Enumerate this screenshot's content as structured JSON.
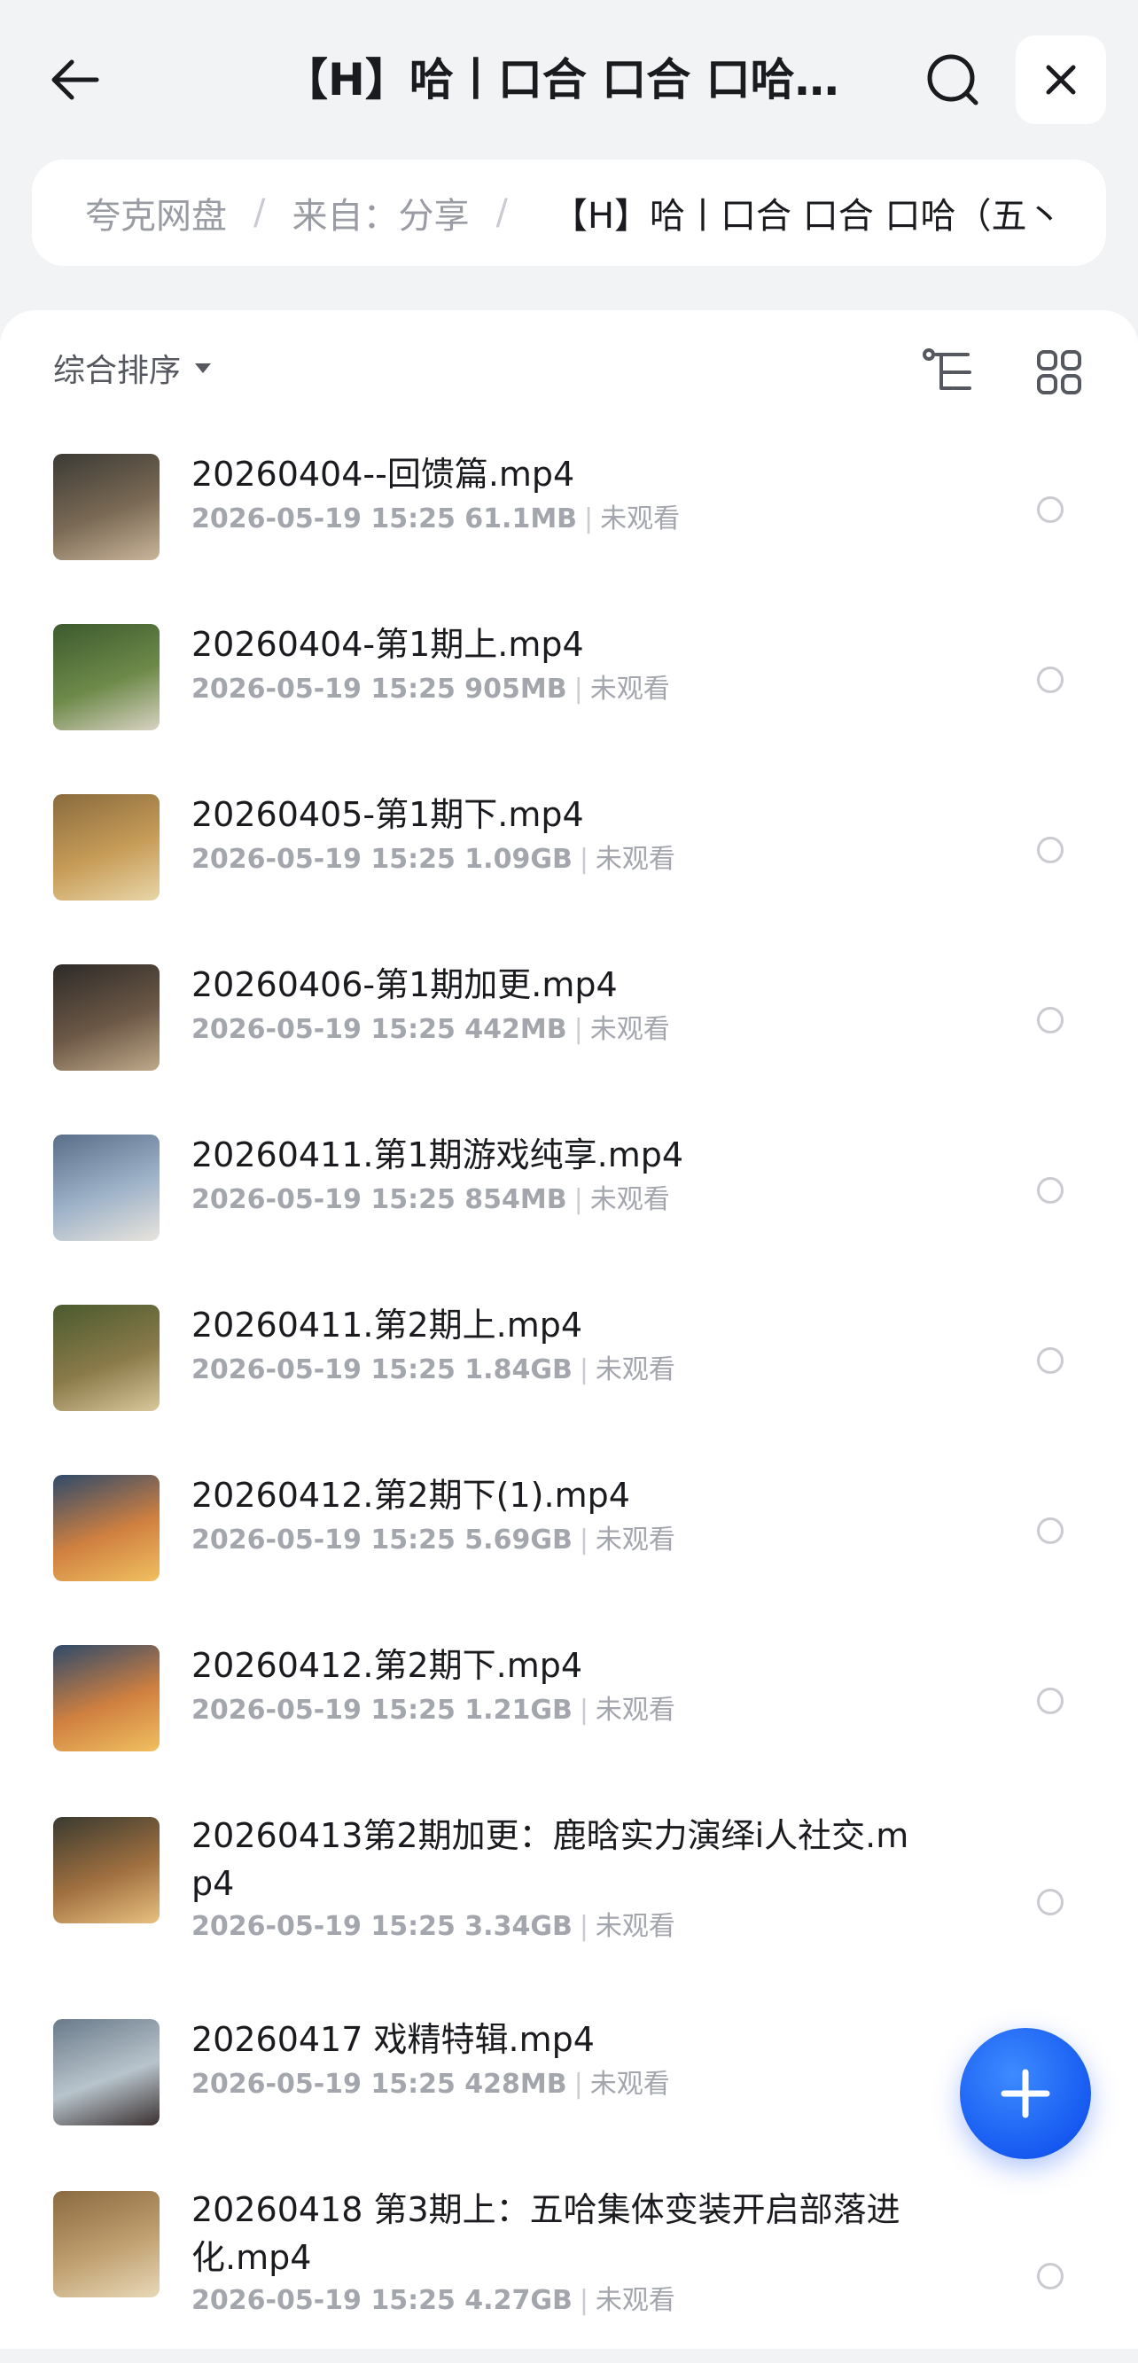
{
  "header": {
    "title": "【H】哈丨口合 口合 口哈（...",
    "back_icon": "arrow-left-icon",
    "search_icon": "search-icon",
    "close_icon": "close-icon"
  },
  "breadcrumb": {
    "items": [
      "夸克网盘",
      "来自：分享"
    ],
    "separator": "/",
    "current": "【H】哈丨口合 口合 口哈（五丶"
  },
  "toolbar": {
    "sort_label": "综合排序",
    "tree_icon": "folder-tree-icon",
    "grid_icon": "grid-view-icon"
  },
  "files": [
    {
      "name": "20260404--回馈篇.mp4",
      "date": "2026-05-19 15:25",
      "size": "61.1MB",
      "status": "未观看"
    },
    {
      "name": "20260404-第1期上.mp4",
      "date": "2026-05-19 15:25",
      "size": "905MB",
      "status": "未观看"
    },
    {
      "name": "20260405-第1期下.mp4",
      "date": "2026-05-19 15:25",
      "size": "1.09GB",
      "status": "未观看"
    },
    {
      "name": "20260406-第1期加更.mp4",
      "date": "2026-05-19 15:25",
      "size": "442MB",
      "status": "未观看"
    },
    {
      "name": "20260411.第1期游戏纯享.mp4",
      "date": "2026-05-19 15:25",
      "size": "854MB",
      "status": "未观看"
    },
    {
      "name": "20260411.第2期上.mp4",
      "date": "2026-05-19 15:25",
      "size": "1.84GB",
      "status": "未观看"
    },
    {
      "name": "20260412.第2期下(1).mp4",
      "date": "2026-05-19 15:25",
      "size": "5.69GB",
      "status": "未观看"
    },
    {
      "name": "20260412.第2期下.mp4",
      "date": "2026-05-19 15:25",
      "size": "1.21GB",
      "status": "未观看"
    },
    {
      "name": "20260413第2期加更：鹿晗实力演绎i人社交.mp4",
      "date": "2026-05-19 15:25",
      "size": "3.34GB",
      "status": "未观看"
    },
    {
      "name": "20260417 戏精特辑.mp4",
      "date": "2026-05-19 15:25",
      "size": "428MB",
      "status": "未观看"
    },
    {
      "name": "20260418 第3期上：五哈集体变装开启部落进化.mp4",
      "date": "2026-05-19 15:25",
      "size": "4.27GB",
      "status": "未观看"
    }
  ],
  "fab": {
    "icon": "plus-icon"
  },
  "colors": {
    "background": "#f2f3f5",
    "surface": "#ffffff",
    "accent": "#1a62f5",
    "text_primary": "#1a1b1f",
    "text_secondary": "#a3a6ad"
  }
}
